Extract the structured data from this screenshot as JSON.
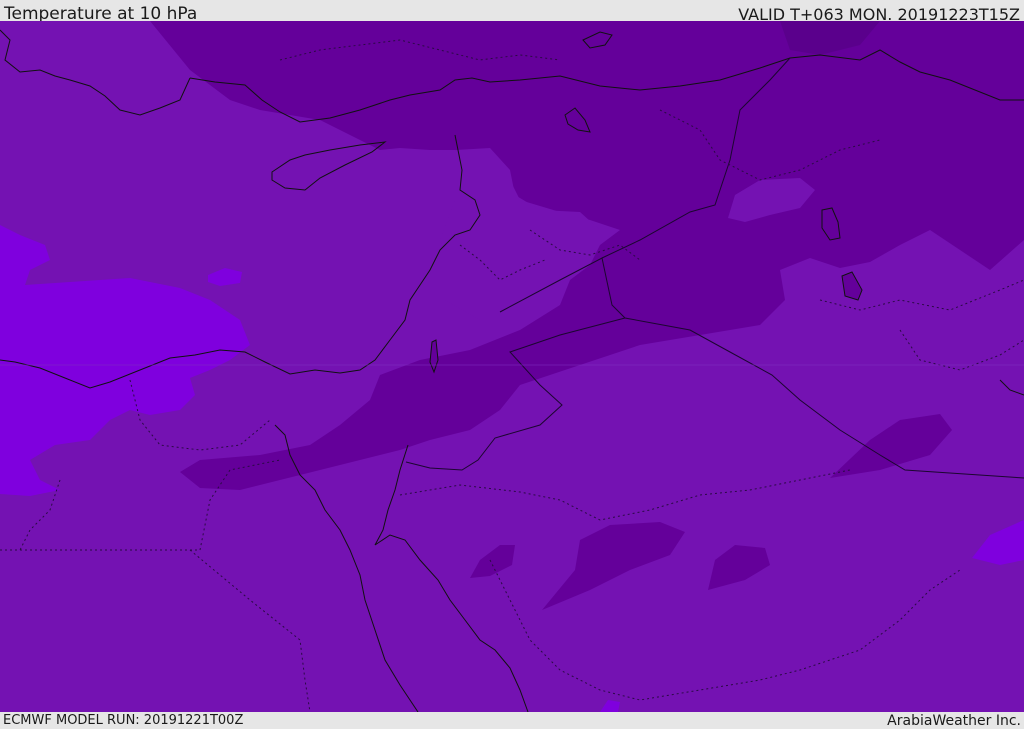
{
  "header": {
    "title": "Temperature at 10 hPa",
    "valid": "VALID T+063 MON. 20191223T15Z"
  },
  "footer": {
    "model_run": "ECMWF MODEL RUN: 20191221T00Z",
    "brand": "ArabiaWeather Inc."
  },
  "map": {
    "field": "temperature",
    "level": "10 hPa",
    "colors": {
      "base": "#7412b2",
      "dark": "#64009a",
      "bright": "#7f00de",
      "coast": "#111111",
      "border": "#2a0a44"
    }
  }
}
